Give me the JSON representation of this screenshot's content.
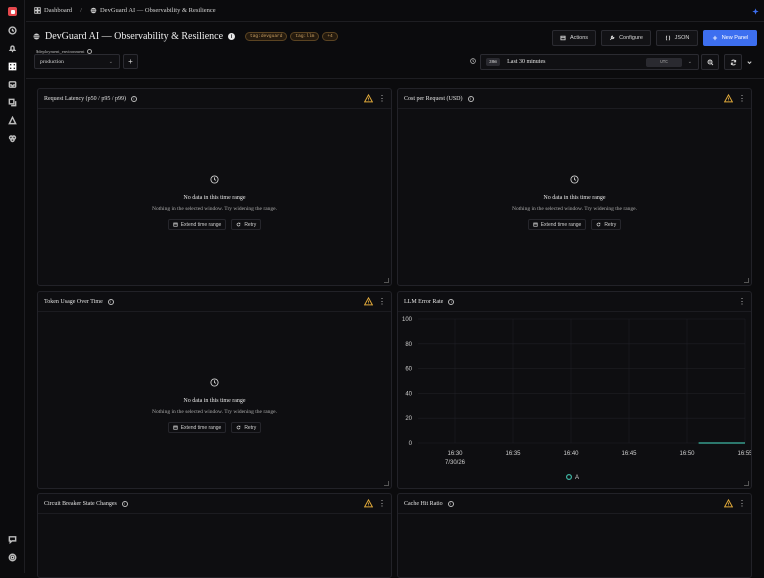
{
  "breadcrumb": {
    "root": "Dashboard",
    "separator": "/",
    "current": "DevGuard AI — Observability & Resilience"
  },
  "header": {
    "title": "DevGuard AI — Observability & Resilience",
    "tags": [
      "tag:devguard",
      "tag:llm",
      "+4"
    ],
    "buttons": {
      "actions": "Actions",
      "configure": "Configure",
      "json": "JSON",
      "new_panel": "New Panel"
    }
  },
  "variable": {
    "label": "$deployment_environment",
    "value": "production"
  },
  "time_picker": {
    "chip": "30m",
    "label": "Last 30 minutes",
    "timezone": "UTC"
  },
  "empty_state": {
    "title": "No data in this time range",
    "subtitle": "Nothing in the selected window. Try widening the range.",
    "extend": "Extend time range",
    "retry": "Retry"
  },
  "panels": [
    {
      "title": "Request Latency (p50 / p95 / p99)"
    },
    {
      "title": "Cost per Request (USD)"
    },
    {
      "title": "Token Usage Over Time"
    },
    {
      "title": "LLM Error Rate"
    },
    {
      "title": "Circuit Breaker State Changes"
    },
    {
      "title": "Cache Hit Ratio"
    }
  ],
  "chart_data": {
    "type": "line",
    "title": "LLM Error Rate",
    "x": [
      "16:30",
      "16:35",
      "16:40",
      "16:45",
      "16:50",
      "16:55"
    ],
    "x_date_label": "7/30/26",
    "ylim": [
      0,
      100
    ],
    "yticks": [
      0,
      20,
      40,
      60,
      80,
      100
    ],
    "series": [
      {
        "name": "A",
        "color": "#3fb7a5",
        "segment_x": [
          "16:51",
          "16:57"
        ],
        "values": [
          0,
          0
        ]
      }
    ],
    "grid": true,
    "legend": "bottom-center"
  },
  "colors": {
    "accent": "#3d6ff0",
    "warning": "#e0a93b",
    "series_a": "#3fb7a5",
    "brand": "#e5484d"
  }
}
